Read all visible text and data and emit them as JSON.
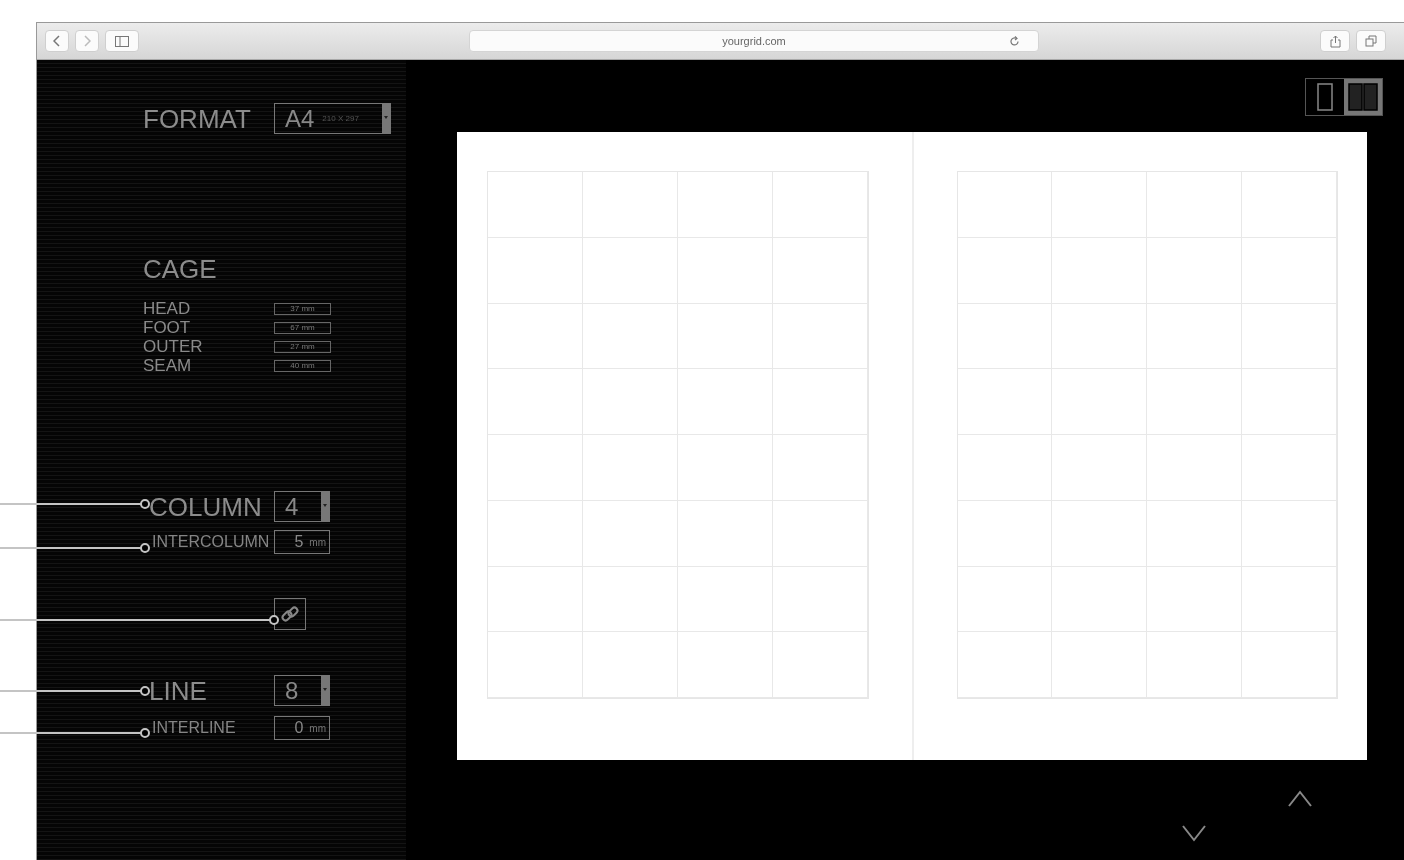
{
  "browser": {
    "url": "yourgrid.com"
  },
  "format": {
    "label": "FORMAT",
    "value": "A4",
    "size": "210 X 297"
  },
  "cage": {
    "title": "CAGE",
    "fields": [
      {
        "label": "HEAD",
        "value": "37 mm"
      },
      {
        "label": "FOOT",
        "value": "67 mm"
      },
      {
        "label": "OUTER",
        "value": "27 mm"
      },
      {
        "label": "SEAM",
        "value": "40 mm"
      }
    ]
  },
  "column": {
    "label": "COLUMN",
    "value": "4"
  },
  "intercolumn": {
    "label": "INTERCOLUMN",
    "value": "5",
    "unit": "mm"
  },
  "line": {
    "label": "LINE",
    "value": "8"
  },
  "interline": {
    "label": "INTERLINE",
    "value": "0",
    "unit": "mm"
  },
  "view_modes": [
    {
      "kind": "single",
      "selected": false
    },
    {
      "kind": "spread",
      "selected": true
    }
  ]
}
